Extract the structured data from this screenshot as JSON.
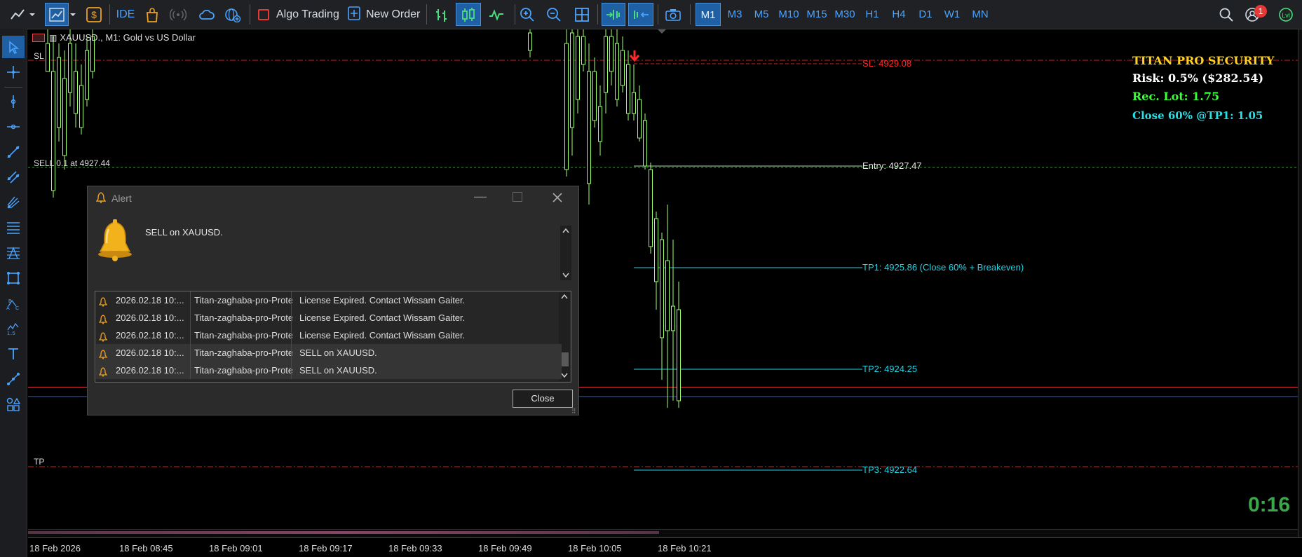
{
  "toolbar": {
    "algo_trading": "Algo Trading",
    "new_order": "New Order",
    "ide": "IDE",
    "timeframes": [
      "M1",
      "M3",
      "M5",
      "M10",
      "M15",
      "M30",
      "H1",
      "H4",
      "D1",
      "W1",
      "MN"
    ],
    "selected_timeframe": "M1",
    "notification_count": "1"
  },
  "chart": {
    "symbol_title": "XAUUSD., M1:  Gold vs US Dollar",
    "sl_label": "SL",
    "tp_label": "TP",
    "sell_label": "SELL  0.1 at 4927.44",
    "sl_line": "SL: 4929.08",
    "entry": "Entry: 4927.47",
    "tp1": "TP1: 4925.86 (Close 60% + Breakeven)",
    "tp2": "TP2: 4924.25",
    "tp3": "TP3: 4922.64",
    "countdown": "0:16",
    "colors": {
      "bull": "#9cff6b",
      "sl": "#ff2a2a",
      "tp": "#22d3e6",
      "entry": "#cccccc"
    }
  },
  "panel": {
    "title": "TITAN PRO SECURITY",
    "risk": "Risk: 0.5% ($282.54)",
    "rec_lot": "Rec. Lot: 1.75",
    "close": "Close 60% @TP1: 1.05"
  },
  "alert": {
    "title": "Alert",
    "message": "SELL on XAUUSD.",
    "close_button": "Close",
    "rows": [
      {
        "time": "2026.02.18 10:...",
        "source": "Titan-zaghaba-pro-Prote...",
        "message": "License Expired. Contact Wissam Gaiter."
      },
      {
        "time": "2026.02.18 10:...",
        "source": "Titan-zaghaba-pro-Prote...",
        "message": "License Expired. Contact Wissam Gaiter."
      },
      {
        "time": "2026.02.18 10:...",
        "source": "Titan-zaghaba-pro-Prote...",
        "message": "License Expired. Contact Wissam Gaiter."
      },
      {
        "time": "2026.02.18 10:...",
        "source": "Titan-zaghaba-pro-Prote...",
        "message": "SELL on XAUUSD."
      },
      {
        "time": "2026.02.18 10:...",
        "source": "Titan-zaghaba-pro-Prote...",
        "message": "SELL on XAUUSD."
      }
    ]
  },
  "time_axis": [
    "18 Feb 2026",
    "18 Feb 08:45",
    "18 Feb 09:01",
    "18 Feb 09:17",
    "18 Feb 09:33",
    "18 Feb 09:49",
    "18 Feb 10:05",
    "18 Feb 10:21"
  ]
}
